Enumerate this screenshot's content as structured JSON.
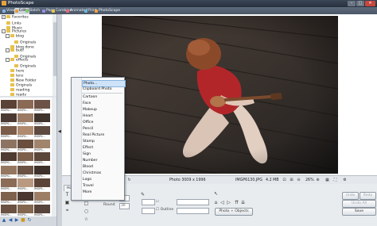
{
  "window": {
    "title": "PhotoScape"
  },
  "tabs": [
    {
      "label": "Viewer",
      "color": "#7fb4e6"
    },
    {
      "label": "Editor",
      "color": "#e79b3a"
    },
    {
      "label": "Batch Editor",
      "color": "#7ecb6a"
    },
    {
      "label": "Page",
      "color": "#9a8de0"
    },
    {
      "label": "Combine",
      "color": "#e5c64a"
    },
    {
      "label": "Animated GIF",
      "color": "#e7687a"
    },
    {
      "label": "Print",
      "color": "#6ab7d9"
    },
    {
      "label": "PhotoScape",
      "color": "#f0a448"
    }
  ],
  "tree": [
    {
      "label": "Favorites",
      "level": 1,
      "exp": "+"
    },
    {
      "label": "Links",
      "level": 1,
      "exp": ""
    },
    {
      "label": "Music",
      "level": 1,
      "exp": ""
    },
    {
      "label": "Pictures",
      "level": 1,
      "exp": "-"
    },
    {
      "label": "blog",
      "level": 2,
      "exp": "-"
    },
    {
      "label": "Originals",
      "level": 3,
      "exp": ""
    },
    {
      "label": "blog done",
      "level": 2,
      "exp": ""
    },
    {
      "label": "bub!",
      "level": 2,
      "exp": "-"
    },
    {
      "label": "Originals",
      "level": 3,
      "exp": ""
    },
    {
      "label": "effects",
      "level": 2,
      "exp": "-"
    },
    {
      "label": "Originals",
      "level": 3,
      "exp": ""
    },
    {
      "label": "here",
      "level": 2,
      "exp": ""
    },
    {
      "label": "lens",
      "level": 2,
      "exp": ""
    },
    {
      "label": "New Folder",
      "level": 2,
      "exp": ""
    },
    {
      "label": "Originals",
      "level": 2,
      "exp": ""
    },
    {
      "label": "reading",
      "level": 2,
      "exp": ""
    },
    {
      "label": "ready",
      "level": 2,
      "exp": ""
    }
  ],
  "thumbnails": [
    {
      "caption": "IMGP0...",
      "color": "#5a4236"
    },
    {
      "caption": "IMGP0...",
      "color": "#8a6a55"
    },
    {
      "caption": "IMGP0...",
      "color": "#6d5347"
    },
    {
      "caption": "IMGP0...",
      "color": "#4b3a33"
    },
    {
      "caption": "IMGP0...",
      "color": "#9b7b63"
    },
    {
      "caption": "IMGP0...",
      "color": "#3f332d"
    },
    {
      "caption": "IMGP0...",
      "color": "#7a5c49"
    },
    {
      "caption": "IMGP0...",
      "color": "#b08b6f"
    },
    {
      "caption": "IMGP0...",
      "color": "#5e4a3f"
    },
    {
      "caption": "IMGP0...",
      "color": "#8d7462"
    },
    {
      "caption": "IMGP0...",
      "color": "#6a4f3f"
    },
    {
      "caption": "IMGP0...",
      "color": "#a1846c"
    },
    {
      "caption": "IMGP0...",
      "color": "#4e3b31"
    },
    {
      "caption": "IMGP0...",
      "color": "#7c604c"
    },
    {
      "caption": "IMGP0...",
      "color": "#5b463a"
    },
    {
      "caption": "IMGP0...",
      "color": "#957760"
    },
    {
      "caption": "IMGP0...",
      "color": "#6b5243"
    },
    {
      "caption": "IMGP0...",
      "color": "#3e302a"
    },
    {
      "caption": "IMGP0...",
      "color": "#8a6c57"
    },
    {
      "caption": "IMGP0...",
      "color": "#b99a80"
    },
    {
      "caption": "IMGP0...",
      "color": "#5c4538"
    },
    {
      "caption": "IMGP0...",
      "color": "#7e614d"
    },
    {
      "caption": "IMGP0...",
      "color": "#4a3830"
    },
    {
      "caption": "IMGP0...",
      "color": "#9c7e67"
    },
    {
      "caption": "IMGP0...",
      "color": "#6a5141"
    },
    {
      "caption": "IMGP0...",
      "color": "#83674f"
    },
    {
      "caption": "IMGP0...",
      "color": "#57443a"
    }
  ],
  "photo_status": {
    "info": "Photo 3009 x 1996",
    "filename": "IMGP6130.JPG",
    "size": "4.2 MB",
    "zoom": "26%"
  },
  "edit_panel": {
    "tab_label": "Hom",
    "thickness_label": "Thickness",
    "thickness_value": "3",
    "round_label": "Round",
    "round_value": "30",
    "outline_label": "Outline",
    "photo_objects_button": "Photo + Objects",
    "undo_button": "Undo",
    "redo_button": "Redo",
    "undo_all_button": "Undo All",
    "save_button": "Save"
  },
  "context_menu": {
    "items": [
      {
        "label": "Photo...",
        "highlighted": true
      },
      {
        "label": "Clipboard Photo",
        "highlighted": false
      },
      {
        "label": "Cartoon",
        "highlighted": false
      },
      {
        "label": "Face",
        "highlighted": false
      },
      {
        "label": "Makeup",
        "highlighted": false
      },
      {
        "label": "Heart",
        "highlighted": false
      },
      {
        "label": "Office",
        "highlighted": false
      },
      {
        "label": "Pencil",
        "highlighted": false
      },
      {
        "label": "Real Picture",
        "highlighted": false
      },
      {
        "label": "Stamp",
        "highlighted": false
      },
      {
        "label": "Effect",
        "highlighted": false
      },
      {
        "label": "Sign",
        "highlighted": false
      },
      {
        "label": "Number",
        "highlighted": false
      },
      {
        "label": "Blood",
        "highlighted": false
      },
      {
        "label": "Christmas",
        "highlighted": false
      },
      {
        "label": "Logo",
        "highlighted": false
      },
      {
        "label": "Travel",
        "highlighted": false
      },
      {
        "label": "More",
        "highlighted": false
      }
    ]
  }
}
